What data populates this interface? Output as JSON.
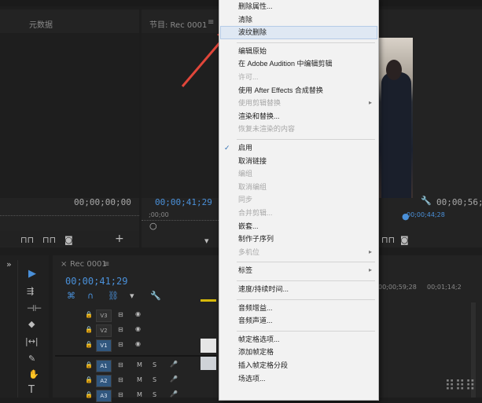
{
  "source_monitor": {
    "tab_label": "元数据",
    "timecode": "00;00;00;00"
  },
  "program_monitor": {
    "title": "节目: Rec 0001",
    "menu_icon": "≡",
    "timecode_left": "00;00;41;29",
    "timecode_right": "00;00;56;0",
    "ruler_start": ";00;00",
    "ruler_end": "00;00;44;28"
  },
  "timeline": {
    "sequence_label": "Rec 0001",
    "menu_icon": "≡",
    "timecode": "00;00;41;29",
    "ruler_marks": [
      "00;00;59;28",
      "00;01;14;2"
    ],
    "tracks": [
      {
        "name": "V3",
        "active": false,
        "audio": false
      },
      {
        "name": "V2",
        "active": false,
        "audio": false
      },
      {
        "name": "V1",
        "active": true,
        "audio": false
      },
      {
        "name": "A1",
        "active": true,
        "audio": true
      },
      {
        "name": "A2",
        "active": true,
        "audio": true
      },
      {
        "name": "A3",
        "active": true,
        "audio": true
      }
    ],
    "mute_label": "M",
    "solo_label": "S"
  },
  "context_menu": {
    "items": [
      {
        "label": "删除属性...",
        "disabled": false
      },
      {
        "label": "清除",
        "disabled": false
      },
      {
        "label": "波纹删除",
        "disabled": false,
        "highlighted": true
      },
      {
        "separator": true
      },
      {
        "label": "编辑原始",
        "disabled": false
      },
      {
        "label": "在 Adobe Audition 中编辑剪辑",
        "disabled": false
      },
      {
        "label": "许可...",
        "disabled": true
      },
      {
        "label": "使用 After Effects 合成替换",
        "disabled": false
      },
      {
        "label": "使用剪辑替换",
        "disabled": true,
        "submenu": true
      },
      {
        "label": "渲染和替换...",
        "disabled": false
      },
      {
        "label": "恢复未渲染的内容",
        "disabled": true
      },
      {
        "separator": true
      },
      {
        "label": "启用",
        "disabled": false,
        "checked": true
      },
      {
        "label": "取消链接",
        "disabled": false
      },
      {
        "label": "编组",
        "disabled": true
      },
      {
        "label": "取消编组",
        "disabled": true
      },
      {
        "label": "同步",
        "disabled": true
      },
      {
        "label": "合并剪辑...",
        "disabled": true
      },
      {
        "label": "嵌套...",
        "disabled": false
      },
      {
        "label": "制作子序列",
        "disabled": false
      },
      {
        "label": "多机位",
        "disabled": true,
        "submenu": true
      },
      {
        "separator": true
      },
      {
        "label": "标签",
        "disabled": false,
        "submenu": true
      },
      {
        "separator": true
      },
      {
        "label": "速度/持续时间...",
        "disabled": false
      },
      {
        "separator": true
      },
      {
        "label": "音频增益...",
        "disabled": false
      },
      {
        "label": "音频声道...",
        "disabled": false
      },
      {
        "separator": true
      },
      {
        "label": "帧定格选项...",
        "disabled": false
      },
      {
        "label": "添加帧定格",
        "disabled": false
      },
      {
        "label": "插入帧定格分段",
        "disabled": false
      },
      {
        "label": "场选项...",
        "disabled": false
      }
    ]
  },
  "colors": {
    "accent": "#4a90d9",
    "arrow": "#e0463a",
    "menu_bg": "#f2f2f2"
  },
  "icons": [
    "play-tool-icon",
    "track-select-icon",
    "ripple-edit-icon",
    "razor-icon",
    "slip-icon",
    "pen-icon",
    "hand-icon",
    "type-icon",
    "wrench-icon",
    "camera-icon",
    "add-icon",
    "magnet-icon",
    "eye-icon",
    "lock-icon",
    "mic-icon"
  ]
}
